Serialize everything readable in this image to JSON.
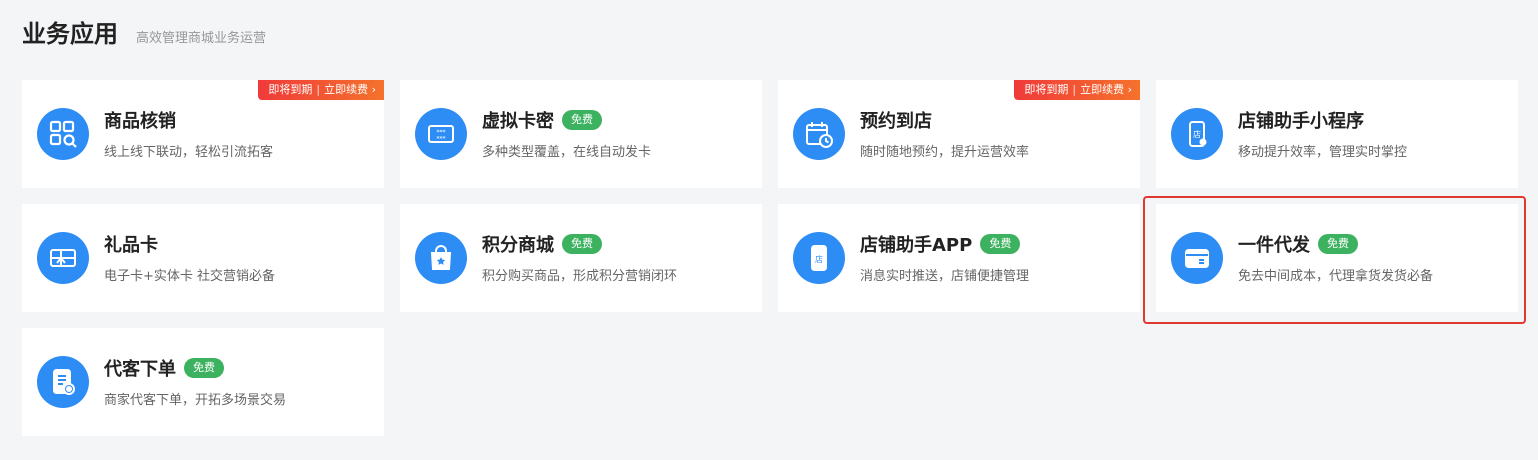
{
  "header": {
    "title": "业务应用",
    "subtitle": "高效管理商城业务运营"
  },
  "colors": {
    "icon_bg": "#2e8df5",
    "badge_free": "#3cb15f",
    "expire_start": "#f03a3a",
    "expire_end": "#f5722c",
    "highlight": "#e0392f"
  },
  "cards": [
    {
      "title": "商品核销",
      "desc": "线上线下联动，轻松引流拓客",
      "badge": "",
      "expire": "即将到期",
      "renew": "立即续费 ›",
      "icon": "qr-scan-icon"
    },
    {
      "title": "虚拟卡密",
      "desc": "多种类型覆盖，在线自动发卡",
      "badge": "免费",
      "icon": "password-card-icon"
    },
    {
      "title": "预约到店",
      "desc": "随时随地预约，提升运营效率",
      "badge": "",
      "expire": "即将到期",
      "renew": "立即续费 ›",
      "icon": "calendar-clock-icon"
    },
    {
      "title": "店铺助手小程序",
      "desc": "移动提升效率，管理实时掌控",
      "badge": "",
      "icon": "mini-program-phone-icon"
    },
    {
      "title": "礼品卡",
      "desc": "电子卡+实体卡 社交营销必备",
      "badge": "",
      "icon": "gift-card-icon"
    },
    {
      "title": "积分商城",
      "desc": "积分购买商品，形成积分营销闭环",
      "badge": "免费",
      "icon": "shopping-bag-star-icon"
    },
    {
      "title": "店铺助手APP",
      "desc": "消息实时推送，店铺便捷管理",
      "badge": "免费",
      "icon": "store-phone-icon"
    },
    {
      "title": "一件代发",
      "desc": "免去中间成本，代理拿货发货必备",
      "badge": "免费",
      "icon": "parcel-box-icon"
    },
    {
      "title": "代客下单",
      "desc": "商家代客下单，开拓多场景交易",
      "badge": "免费",
      "icon": "order-list-icon"
    }
  ]
}
